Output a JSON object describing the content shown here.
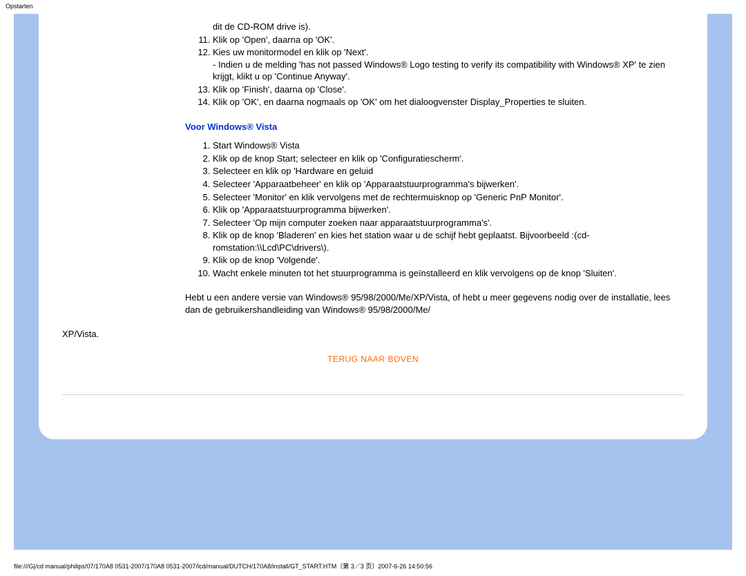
{
  "page_title_small": "Opstarten",
  "xp_list_continued": [
    {
      "n": "",
      "text": "dit de CD-ROM drive is)."
    },
    {
      "n": "11",
      "text": "Klik op 'Open', daarna op 'OK'."
    },
    {
      "n": "12",
      "text": "Kies uw monitormodel en klik op 'Next'."
    },
    {
      "n": "12sub",
      "text": "- Indien u de melding 'has not passed Windows® Logo testing to verify its compatibility with Windows® XP' te zien krijgt, klikt u op 'Continue Anyway'."
    },
    {
      "n": "13",
      "text": "Klik op 'Finish', daarna op 'Close'."
    },
    {
      "n": "14",
      "text": "Klik op 'OK', en daarna nogmaals op 'OK' om het dialoogvenster Display_Properties te sluiten."
    }
  ],
  "vista_heading": "Voor Windows® Vista",
  "vista_list": [
    "Start Windows® Vista",
    "Klik op de knop Start; selecteer en klik op 'Configuratiescherm'.",
    "Selecteer en klik op 'Hardware en geluid",
    "Selecteer 'Apparaatbeheer' en klik op 'Apparaatstuurprogramma's bijwerken'.",
    "Selecteer 'Monitor' en klik vervolgens met de rechtermuisknop op 'Generic PnP Monitor'.",
    "Klik op 'Apparaatstuurprogramma bijwerken'.",
    "Selecteer 'Op mijn computer zoeken naar apparaatstuurprogramma's'.",
    "Klik op de knop 'Bladeren' en kies het station waar u de schijf hebt geplaatst. Bijvoorbeeld :(cd-romstation:\\\\Lcd\\PC\\drivers\\).",
    "Klik op de knop 'Volgende'.",
    "Wacht enkele minuten tot het stuurprogramma is geïnstalleerd en klik vervolgens op de knop 'Sluiten'."
  ],
  "closing_para": "Hebt u een andere versie van Windows® 95/98/2000/Me/XP/Vista, of hebt u meer gegevens nodig over de installatie, lees dan de gebruikershandleiding van Windows® 95/98/2000/Me/",
  "xp_vista_line": "XP/Vista.",
  "back_to_top": "TERUG NAAR BOVEN",
  "footer_path": "file:///G|/cd manual/philips/07/170A8 0531-2007/170A8 0531-2007/lcd/manual/DUTCH/170A8/install/GT_START.HTM（第 3／3 页）2007-6-26 14:50:56"
}
